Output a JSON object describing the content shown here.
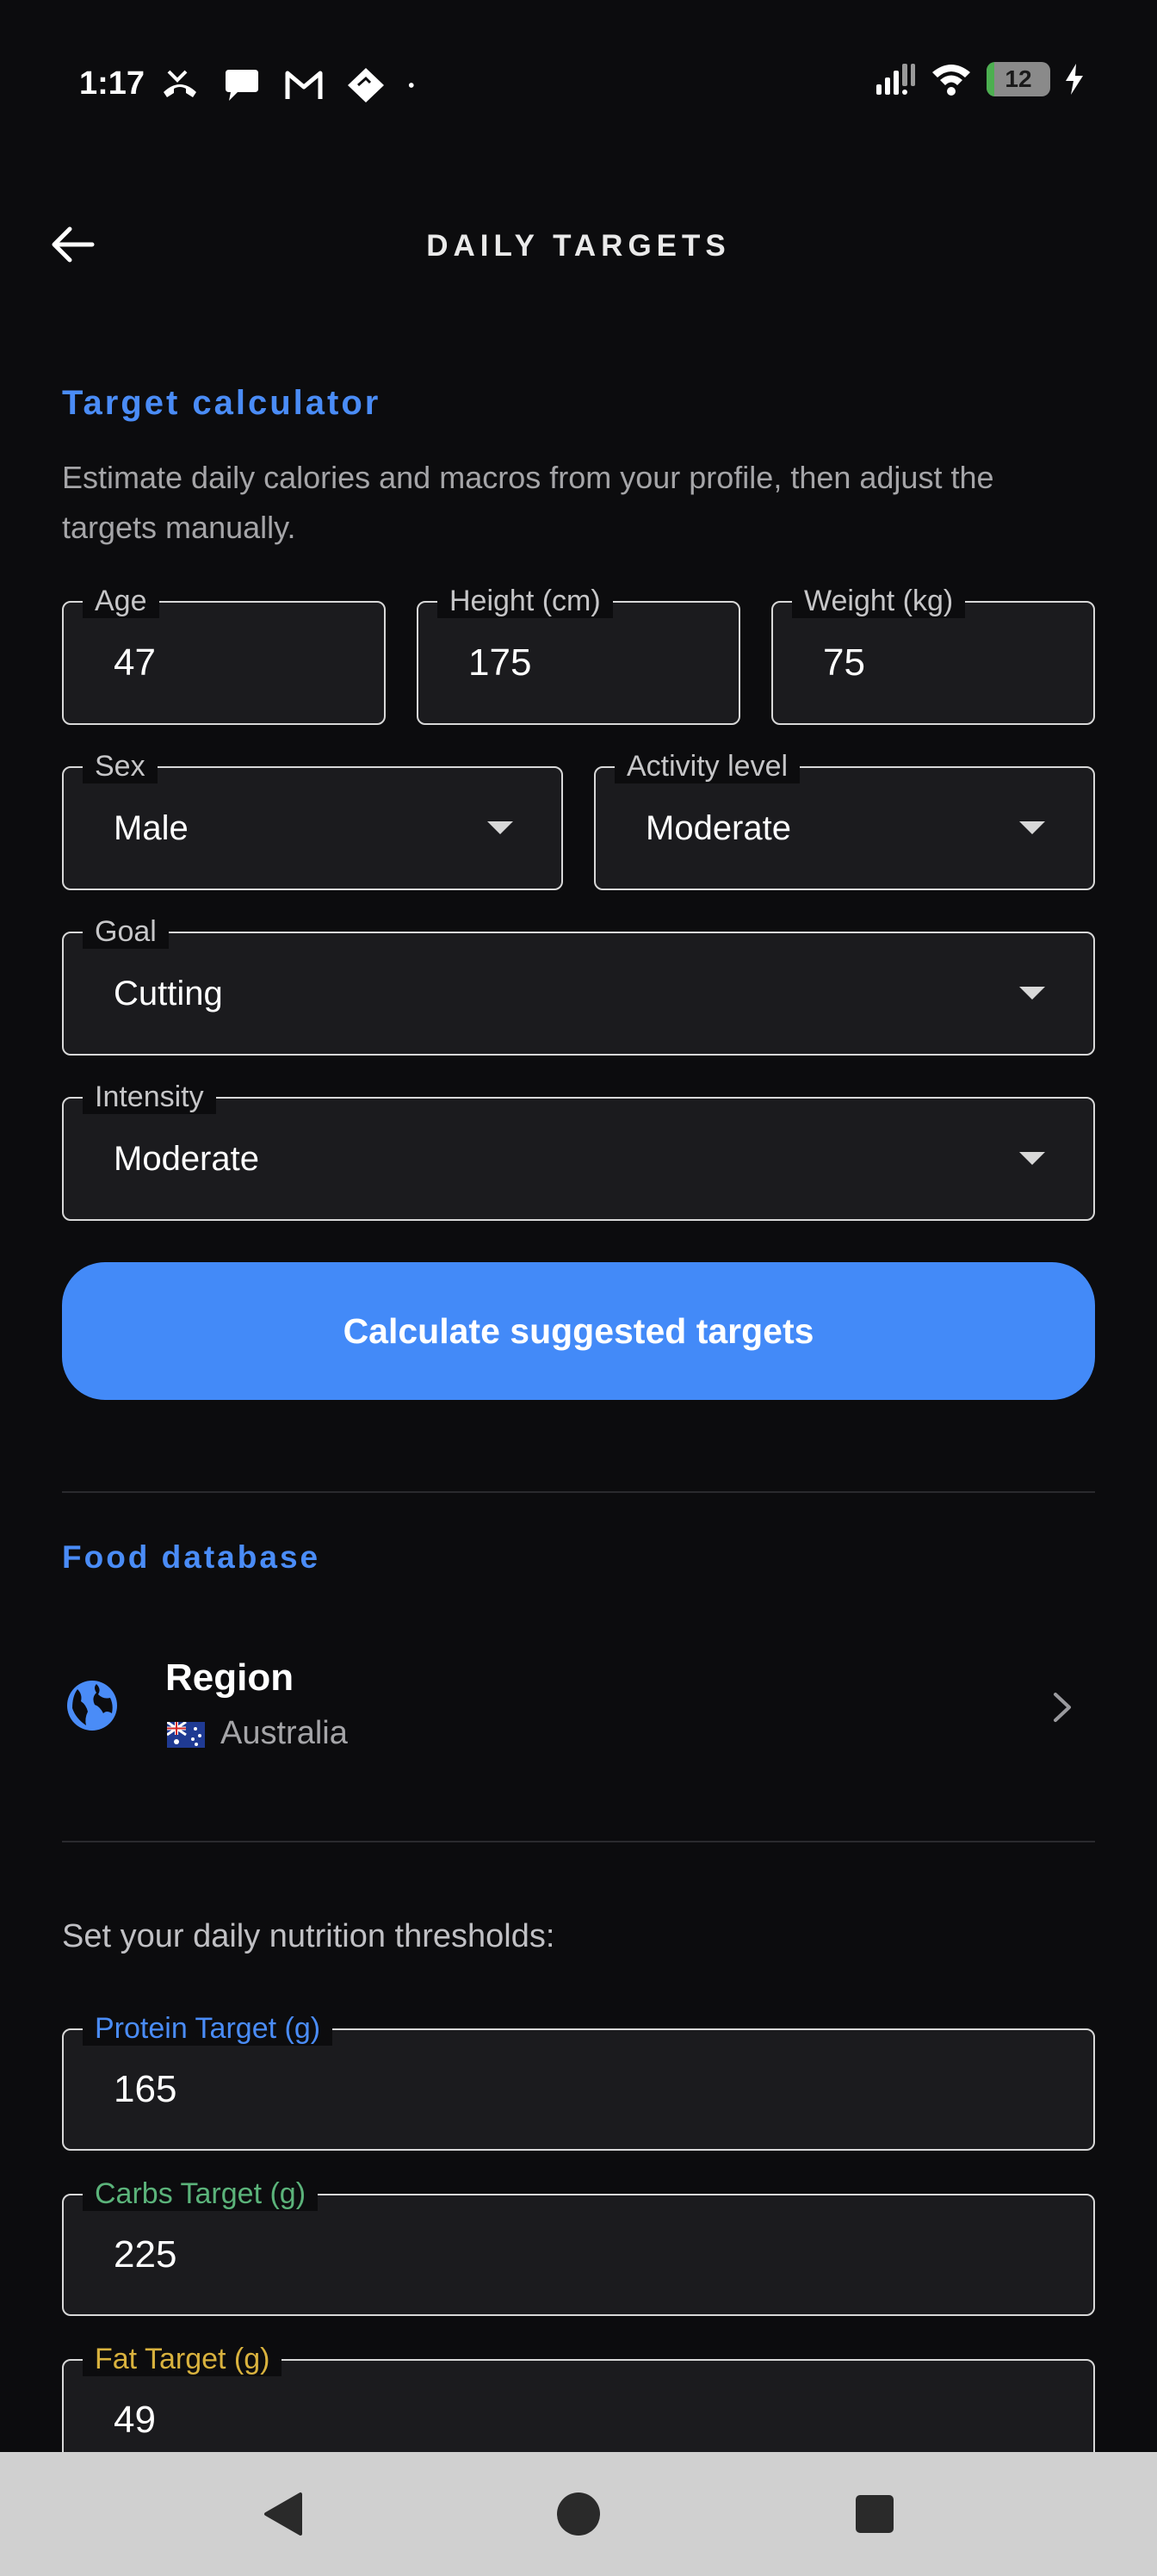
{
  "status_bar": {
    "time": "1:17",
    "battery_level": "12",
    "battery_fraction": 0.12,
    "icons": [
      "missed-call-icon",
      "chat-bubble-icon",
      "gmail-icon",
      "diamond-icon",
      "dot-icon",
      "signal-icon",
      "wifi-icon",
      "battery-icon",
      "charging-icon"
    ]
  },
  "header": {
    "title": "DAILY TARGETS",
    "back_icon": "arrow-left-icon"
  },
  "calculator": {
    "section_title": "Target calculator",
    "description": "Estimate daily calories and macros from your profile, then adjust the targets manually.",
    "age": {
      "label": "Age",
      "value": "47"
    },
    "height": {
      "label": "Height (cm)",
      "value": "175"
    },
    "weight": {
      "label": "Weight (kg)",
      "value": "75"
    },
    "sex": {
      "label": "Sex",
      "value": "Male"
    },
    "activity": {
      "label": "Activity level",
      "value": "Moderate"
    },
    "goal": {
      "label": "Goal",
      "value": "Cutting"
    },
    "intensity": {
      "label": "Intensity",
      "value": "Moderate"
    },
    "button_label": "Calculate suggested targets"
  },
  "food_database": {
    "section_title": "Food database",
    "region_title": "Region",
    "region_value": "Australia",
    "region_icon": "globe-icon"
  },
  "thresholds": {
    "intro": "Set your daily nutrition thresholds:",
    "protein": {
      "label": "Protein Target (g)",
      "value": "165",
      "color": "#4a8cf7"
    },
    "carbs": {
      "label": "Carbs Target (g)",
      "value": "225",
      "color": "#5bb37a"
    },
    "fat": {
      "label": "Fat Target (g)",
      "value": "49",
      "color": "#d9b23e"
    }
  },
  "colors": {
    "accent": "#4a8cf7",
    "button": "#438af8",
    "background": "#0c0c0e",
    "field_bg": "#1b1b1e"
  },
  "nav_bar": {
    "icons": [
      "nav-back-icon",
      "nav-home-icon",
      "nav-recents-icon"
    ]
  }
}
